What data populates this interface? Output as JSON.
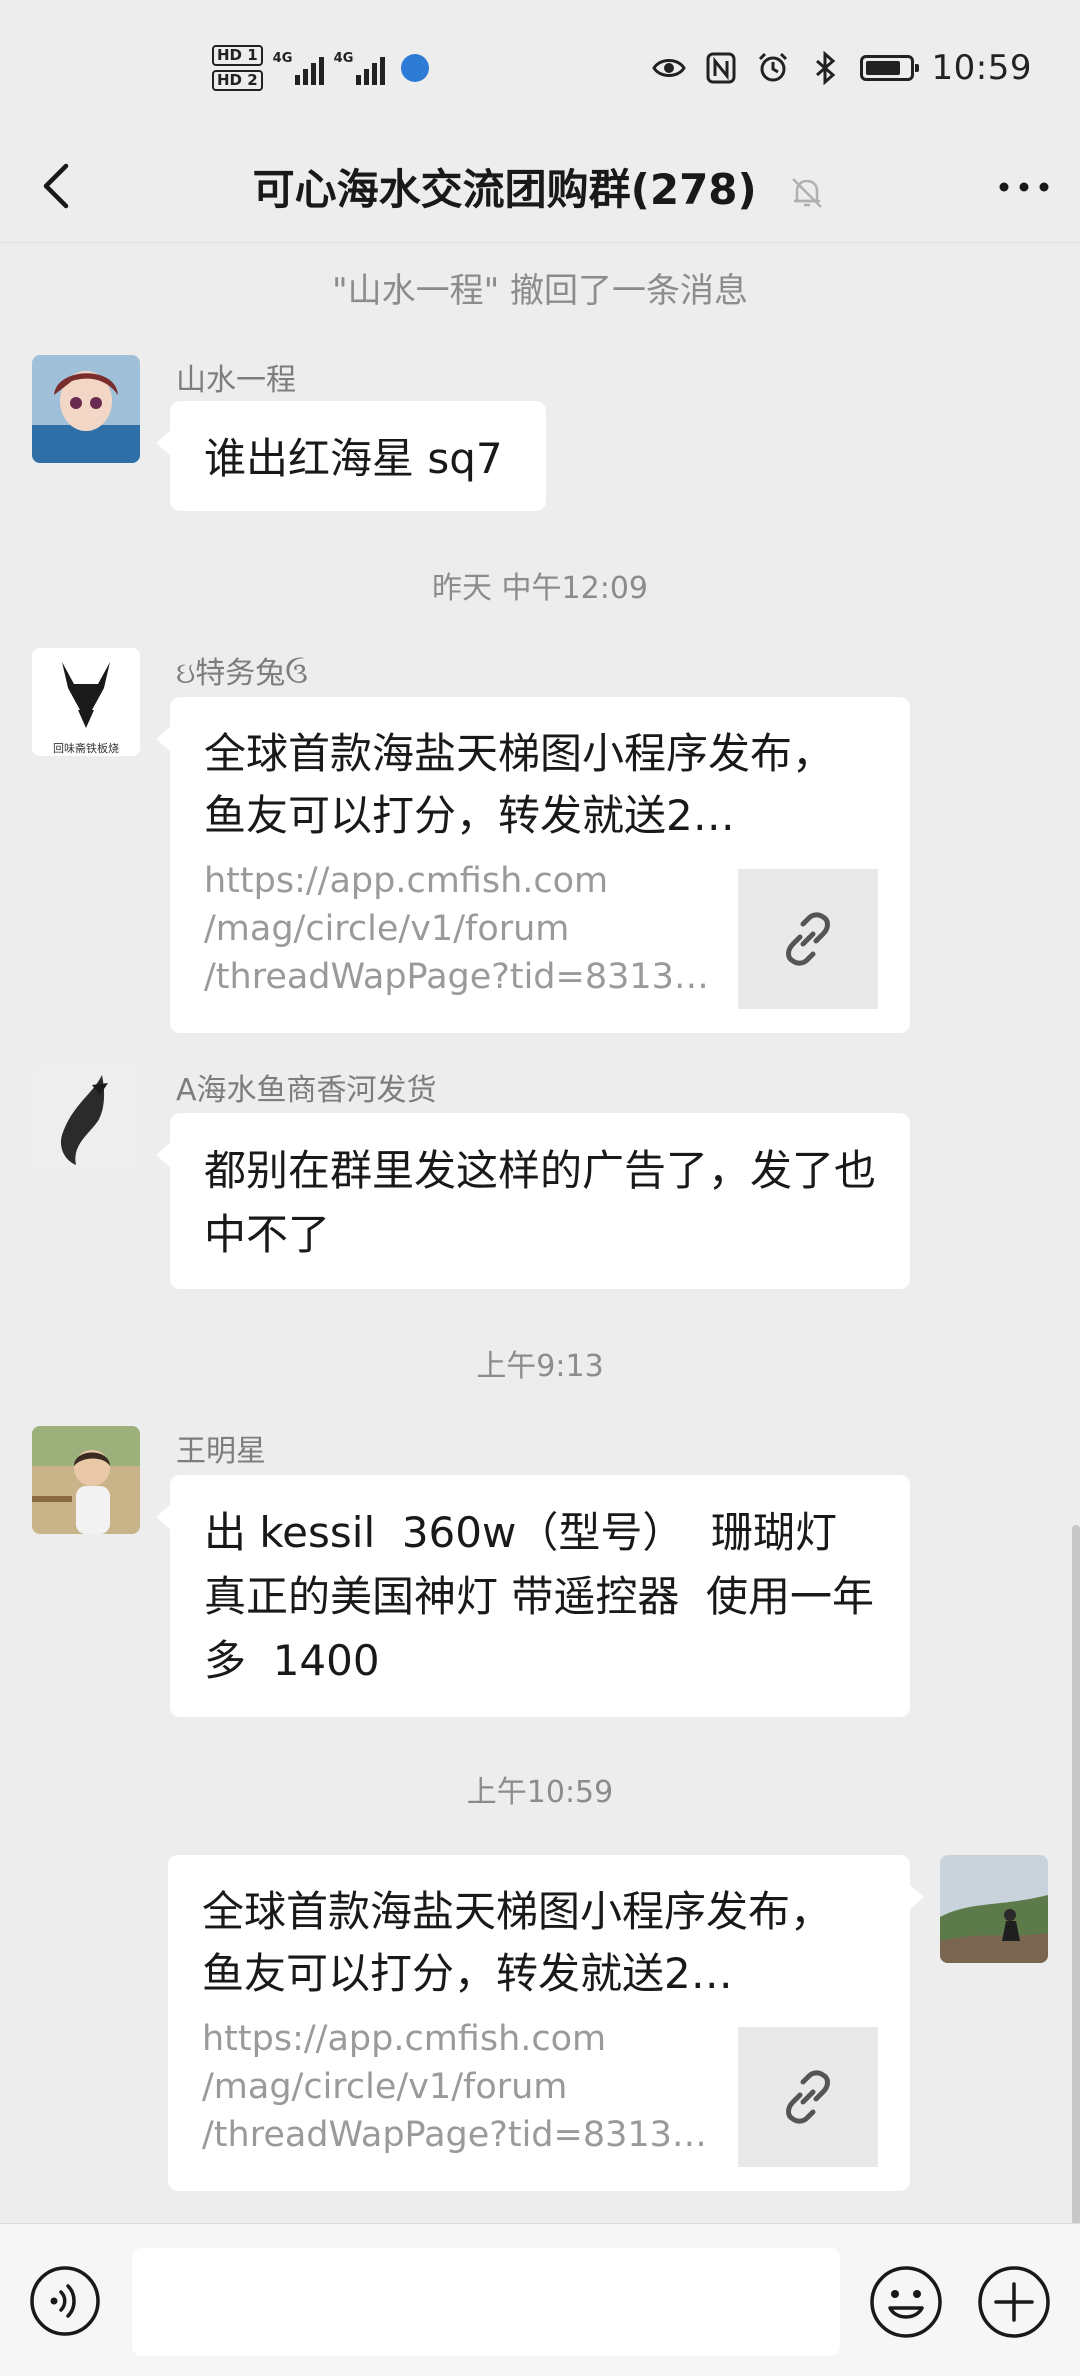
{
  "status_bar": {
    "sim1": "HD 1",
    "sim2": "HD 2",
    "net1": "4G",
    "net2": "4G",
    "time": "10:59",
    "battery_level": 0.8
  },
  "nav": {
    "title": "可心海水交流团购群(278)",
    "back_icon": "chevron-left-icon",
    "mute_icon": "bell-muted-icon",
    "more_icon": "more-dots-icon"
  },
  "messages": {
    "recall_notice": "\"山水一程\" 撤回了一条消息",
    "m1": {
      "sender": "山水一程",
      "text": "谁出红海星 sq7"
    },
    "t1": "昨天 中午12:09",
    "m2": {
      "sender": "ઇ特务兔ઉ",
      "link_title": "全球首款海盐天梯图小程序发布，鱼友可以打分，转发就送2…",
      "link_url": "https://app.cmfish.com\n/mag/circle/v1/forum\n/threadWapPage?tid=8313…",
      "avatar_caption": "回味斋铁板烧"
    },
    "m3": {
      "sender": "A海水鱼商香河发货",
      "text": "都别在群里发这样的广告了，发了也中不了"
    },
    "t2": "上午9:13",
    "m4": {
      "sender": "王明星",
      "text": "出 kessil  360w（型号）  珊瑚灯  真正的美国神灯 带遥控器  使用一年多  1400"
    },
    "t3": "上午10:59",
    "m5": {
      "link_title": "全球首款海盐天梯图小程序发布，鱼友可以打分，转发就送2…",
      "link_url": "https://app.cmfish.com\n/mag/circle/v1/forum\n/threadWapPage?tid=8313…"
    }
  },
  "input_bar": {
    "placeholder": "",
    "voice_icon": "voice-icon",
    "emoji_icon": "emoji-icon",
    "plus_icon": "plus-circle-icon"
  }
}
